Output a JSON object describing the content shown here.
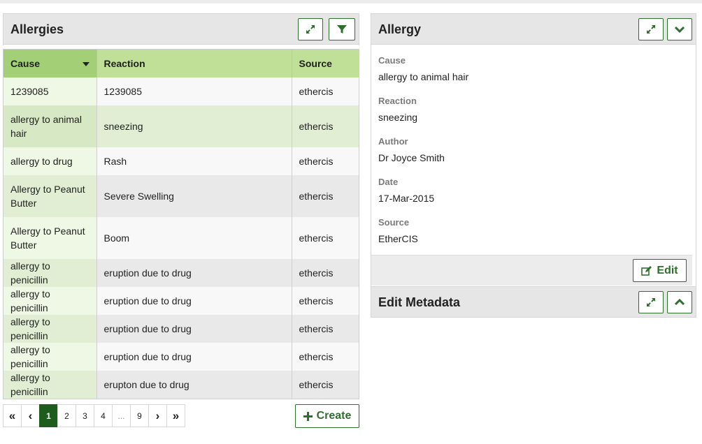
{
  "allergies_panel": {
    "title": "Allergies",
    "expand_icon": "expand-arrows-icon",
    "filter_icon": "filter-funnel-icon"
  },
  "table": {
    "columns": [
      "Cause",
      "Reaction",
      "Source"
    ],
    "sorted_column": "Cause",
    "rows": [
      {
        "cause": "1239085",
        "reaction": "1239085",
        "source": "ethercis"
      },
      {
        "cause": "allergy to animal hair",
        "reaction": "sneezing",
        "source": "ethercis"
      },
      {
        "cause": "allergy to drug",
        "reaction": "Rash",
        "source": "ethercis"
      },
      {
        "cause": "Allergy to Peanut Butter",
        "reaction": "Severe Swelling",
        "source": "ethercis"
      },
      {
        "cause": "Allergy to Peanut Butter",
        "reaction": "Boom",
        "source": "ethercis"
      },
      {
        "cause": "allergy to penicillin",
        "reaction": "eruption due to drug",
        "source": "ethercis"
      },
      {
        "cause": "allergy to penicillin",
        "reaction": "eruption due to drug",
        "source": "ethercis"
      },
      {
        "cause": "allergy to penicillin",
        "reaction": "eruption due to drug",
        "source": "ethercis"
      },
      {
        "cause": "allergy to penicillin",
        "reaction": "eruption due to drug",
        "source": "ethercis"
      },
      {
        "cause": "allergy to penicillin",
        "reaction": "erupton due to drug",
        "source": "ethercis"
      }
    ]
  },
  "pagination": {
    "first": "«",
    "prev": "‹",
    "pages": [
      "1",
      "2",
      "3",
      "4",
      "...",
      "9"
    ],
    "active_page": "1",
    "next": "›",
    "last": "»"
  },
  "create_button": {
    "label": "Create",
    "icon": "plus-icon"
  },
  "detail_panel": {
    "title": "Allergy",
    "fields": [
      {
        "label": "Cause",
        "value": "allergy to animal hair"
      },
      {
        "label": "Reaction",
        "value": "sneezing"
      },
      {
        "label": "Author",
        "value": "Dr Joyce Smith"
      },
      {
        "label": "Date",
        "value": "17-Mar-2015"
      },
      {
        "label": "Source",
        "value": "EtherCIS"
      }
    ],
    "edit_button": {
      "label": "Edit",
      "icon": "edit-pencil-icon"
    },
    "collapse_icon": "chevron-down-icon"
  },
  "metadata_panel": {
    "title": "Edit Metadata",
    "expand_icon": "expand-arrows-icon",
    "toggle_icon": "chevron-up-icon"
  },
  "colors": {
    "accent": "#2e6f2e",
    "header_green": "#c0e097",
    "sorted_header": "#a3cf77",
    "active_page": "#1e5c1e"
  }
}
